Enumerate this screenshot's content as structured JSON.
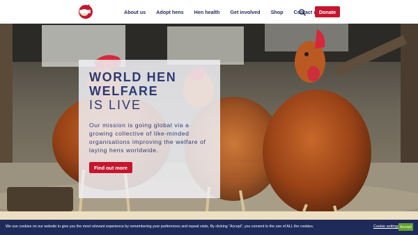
{
  "header": {
    "logo_name": "hen-logo",
    "nav_items": [
      {
        "label": "About us"
      },
      {
        "label": "Adopt hens"
      },
      {
        "label": "Hen health"
      },
      {
        "label": "Get involved"
      },
      {
        "label": "Shop"
      },
      {
        "label": "Contact us"
      }
    ],
    "search_icon": "search-icon",
    "donate_label": "Donate"
  },
  "hero": {
    "title": "WORLD HEN WELFARE",
    "subtitle": "IS LIVE",
    "text": "Our mission is going global via a growing collective of like-minded organisations improving the welfare of laying hens worldwide.",
    "button_label": "Find out more"
  },
  "cookie": {
    "text": "We use cookies on our website to give you the most relevant experience by remembering your preferences and repeat visits. By clicking “Accept”, you consent to the use of ALL the cookies.",
    "settings_label": "Cookie settings",
    "accept_label": "Accept"
  },
  "colors": {
    "brand_red": "#c5162e",
    "navy": "#1e2a5a",
    "accept_green": "#61a229"
  }
}
